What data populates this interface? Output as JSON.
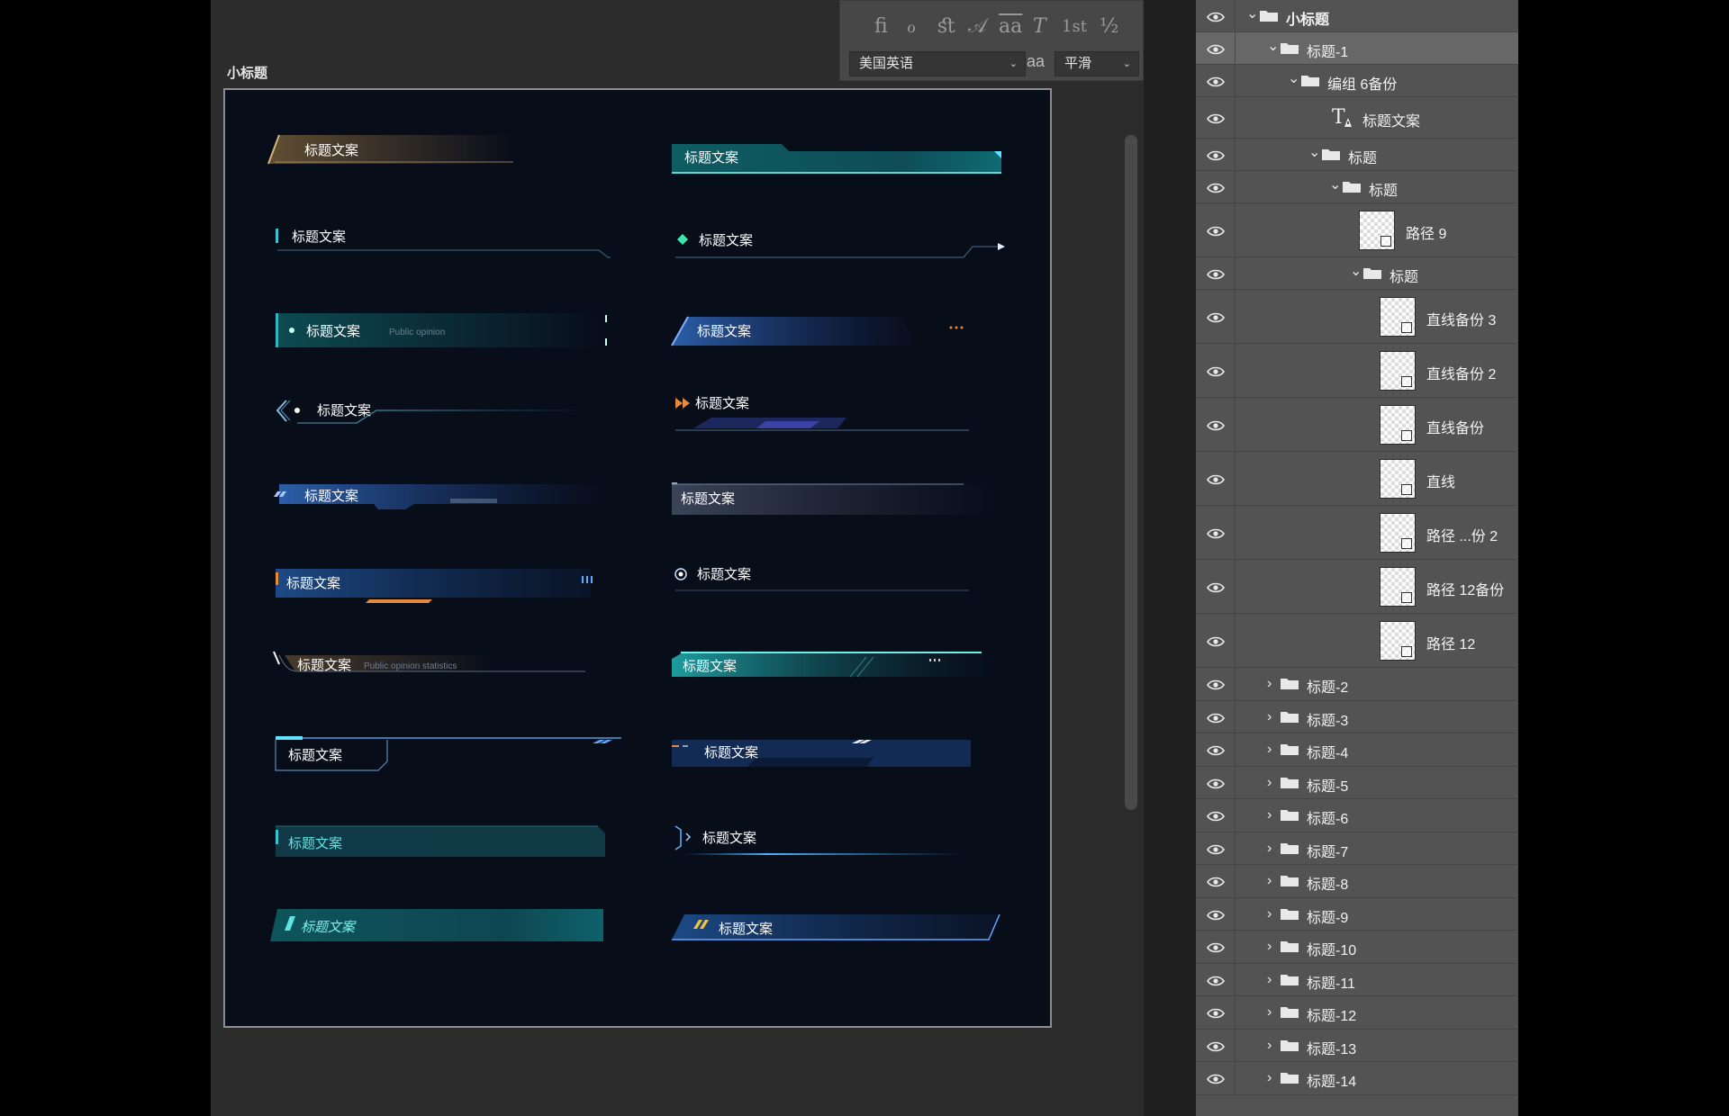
{
  "artboard": {
    "label": "小标题",
    "titles": [
      "标题文案",
      "标题文案",
      "标题文案",
      "标题文案",
      "标题文案",
      "标题文案",
      "标题文案",
      "标题文案",
      "标题文案",
      "标题文案",
      "标题文案",
      "标题文案",
      "标题文案",
      "标题文案",
      "标题文案",
      "标题文案",
      "标题文案",
      "标题文案",
      "标题文案",
      "标题文案"
    ],
    "subtitles": [
      "Public opinion",
      "Public opinion statistics"
    ]
  },
  "character_panel": {
    "glyphs": [
      "ﬁ",
      "ℴ",
      "ﬆ",
      "𝒜",
      "aa",
      "T",
      "1st",
      "½"
    ],
    "language": "美国英语",
    "antialias": "平滑",
    "aa_icon": "aa"
  },
  "layers": [
    {
      "name": "小标题",
      "kind": "group",
      "expanded": true,
      "depth": 0
    },
    {
      "name": "标题-1",
      "kind": "group",
      "expanded": true,
      "depth": 1,
      "selected": true
    },
    {
      "name": "编组 6备份",
      "kind": "group",
      "expanded": true,
      "depth": 2
    },
    {
      "name": "标题文案",
      "kind": "text",
      "depth": 3
    },
    {
      "name": "标题",
      "kind": "group",
      "expanded": true,
      "depth": 3
    },
    {
      "name": "标题",
      "kind": "group",
      "expanded": true,
      "depth": 4
    },
    {
      "name": "路径 9",
      "kind": "shape",
      "depth": 5
    },
    {
      "name": "标题",
      "kind": "group",
      "expanded": true,
      "depth": 5
    },
    {
      "name": "直线备份 3",
      "kind": "shape",
      "depth": 6
    },
    {
      "name": "直线备份 2",
      "kind": "shape",
      "depth": 6
    },
    {
      "name": "直线备份",
      "kind": "shape",
      "depth": 6
    },
    {
      "name": "直线",
      "kind": "shape",
      "depth": 6
    },
    {
      "name": "路径 ...份 2",
      "kind": "shape",
      "depth": 6
    },
    {
      "name": "路径 12备份",
      "kind": "shape",
      "depth": 6
    },
    {
      "name": "路径 12",
      "kind": "shape",
      "depth": 6
    },
    {
      "name": "标题-2",
      "kind": "group",
      "expanded": false,
      "depth": 1
    },
    {
      "name": "标题-3",
      "kind": "group",
      "expanded": false,
      "depth": 1
    },
    {
      "name": "标题-4",
      "kind": "group",
      "expanded": false,
      "depth": 1
    },
    {
      "name": "标题-5",
      "kind": "group",
      "expanded": false,
      "depth": 1
    },
    {
      "name": "标题-6",
      "kind": "group",
      "expanded": false,
      "depth": 1
    },
    {
      "name": "标题-7",
      "kind": "group",
      "expanded": false,
      "depth": 1
    },
    {
      "name": "标题-8",
      "kind": "group",
      "expanded": false,
      "depth": 1
    },
    {
      "name": "标题-9",
      "kind": "group",
      "expanded": false,
      "depth": 1
    },
    {
      "name": "标题-10",
      "kind": "group",
      "expanded": false,
      "depth": 1
    },
    {
      "name": "标题-11",
      "kind": "group",
      "expanded": false,
      "depth": 1
    },
    {
      "name": "标题-12",
      "kind": "group",
      "expanded": false,
      "depth": 1
    },
    {
      "name": "标题-13",
      "kind": "group",
      "expanded": false,
      "depth": 1
    },
    {
      "name": "标题-14",
      "kind": "group",
      "expanded": false,
      "depth": 1
    }
  ],
  "colors": {
    "artboard_bg": "#080d1a",
    "teal": "#1fa3a3",
    "blue": "#2f63b8",
    "gold": "#c9a46a",
    "orange": "#e58a3a",
    "cyan": "#5fe3ff"
  }
}
